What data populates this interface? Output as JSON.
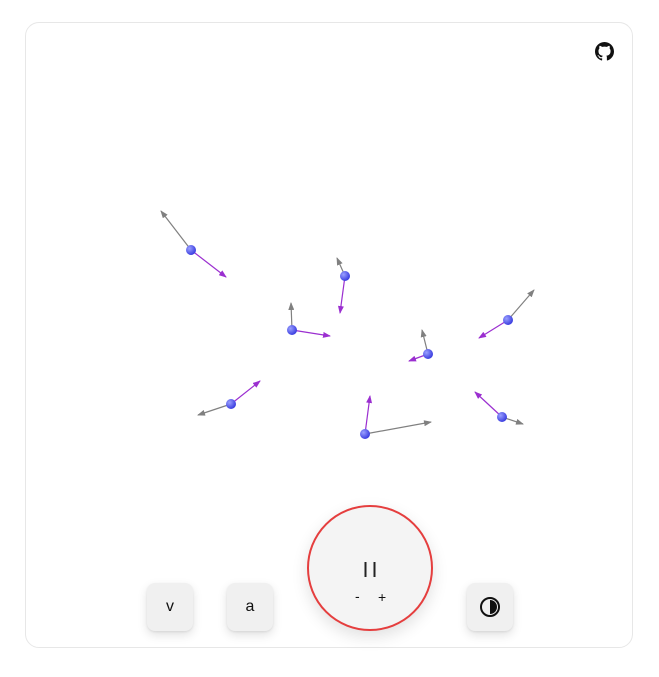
{
  "controls": {
    "velocity_label": "v",
    "acceleration_label": "a",
    "decrease_label": "-",
    "increase_label": "+",
    "play_state": "paused",
    "theme_icon": "contrast-icon",
    "github_icon": "github-icon"
  },
  "colors": {
    "particle": "#5b5cf6",
    "velocity_arrow": "#808080",
    "acceleration_arrow": "#9b2fd0",
    "play_border": "#e53e3e"
  }
}
